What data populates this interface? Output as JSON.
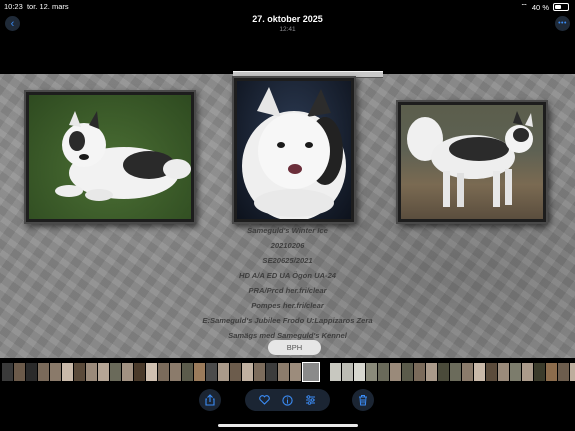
{
  "status_bar": {
    "time": "10:23",
    "date": "tor. 12. mars",
    "battery": "40 %",
    "battery_level": 0.4
  },
  "header": {
    "date": "27. oktober 2025",
    "time": "12:41"
  },
  "photo": {
    "caption_lines": [
      "Sameguld's Winter Ice",
      "20210206",
      "SE20625/2021",
      "HD A/A ED UA Ögon UA-24",
      "PRA/Prcd her.fri/clear",
      "Pompes her.fri/clear",
      "E:Sameguld's Jubilee Frodo U:Lappizaros Zera",
      "Samägs med Sameguld's Kennel"
    ]
  },
  "bph_label": "BPH",
  "filmstrip": {
    "colors_left": [
      "#3a3a3a",
      "#6b5a4a",
      "#2a2a2a",
      "#7a6a5a",
      "#8a7a6a",
      "#c9b9a9",
      "#5a4a3a",
      "#9a8a7a",
      "#b5a595",
      "#6a6a5a",
      "#a29282",
      "#4a3a2a",
      "#d0c0b0",
      "#7b6b5b",
      "#8b7b6b",
      "#5b5b4b",
      "#9b7b5b",
      "#4b4b4b",
      "#aa9a8a",
      "#6c5c4c",
      "#c0b0a0",
      "#7c6c5c",
      "#3c3c3c",
      "#8c7c6c",
      "#9c8c7c"
    ],
    "colors_right": [
      "#c8c8c0",
      "#bcbcb4",
      "#d8d8d0",
      "#8a8a7a",
      "#6a6a5a",
      "#9a8a7a",
      "#5a5a4a",
      "#7a6a5a",
      "#aa9a8a",
      "#4a4a3a",
      "#6b6b5b",
      "#8b7b6b",
      "#c9b9a9",
      "#5b4b3b",
      "#9b8b7b",
      "#7c7c6c",
      "#ab9b8b",
      "#3b3b2b",
      "#8c6c4c",
      "#6d5d4d",
      "#bdad9d",
      "#4d3d2d",
      "#9d7d5d",
      "#7e6e5e",
      "#5e5e4e",
      "#8e8e7e"
    ]
  },
  "colors": {
    "accent": "#3b8cf5",
    "background": "#000000",
    "caption_text": "#3e3e3e"
  }
}
